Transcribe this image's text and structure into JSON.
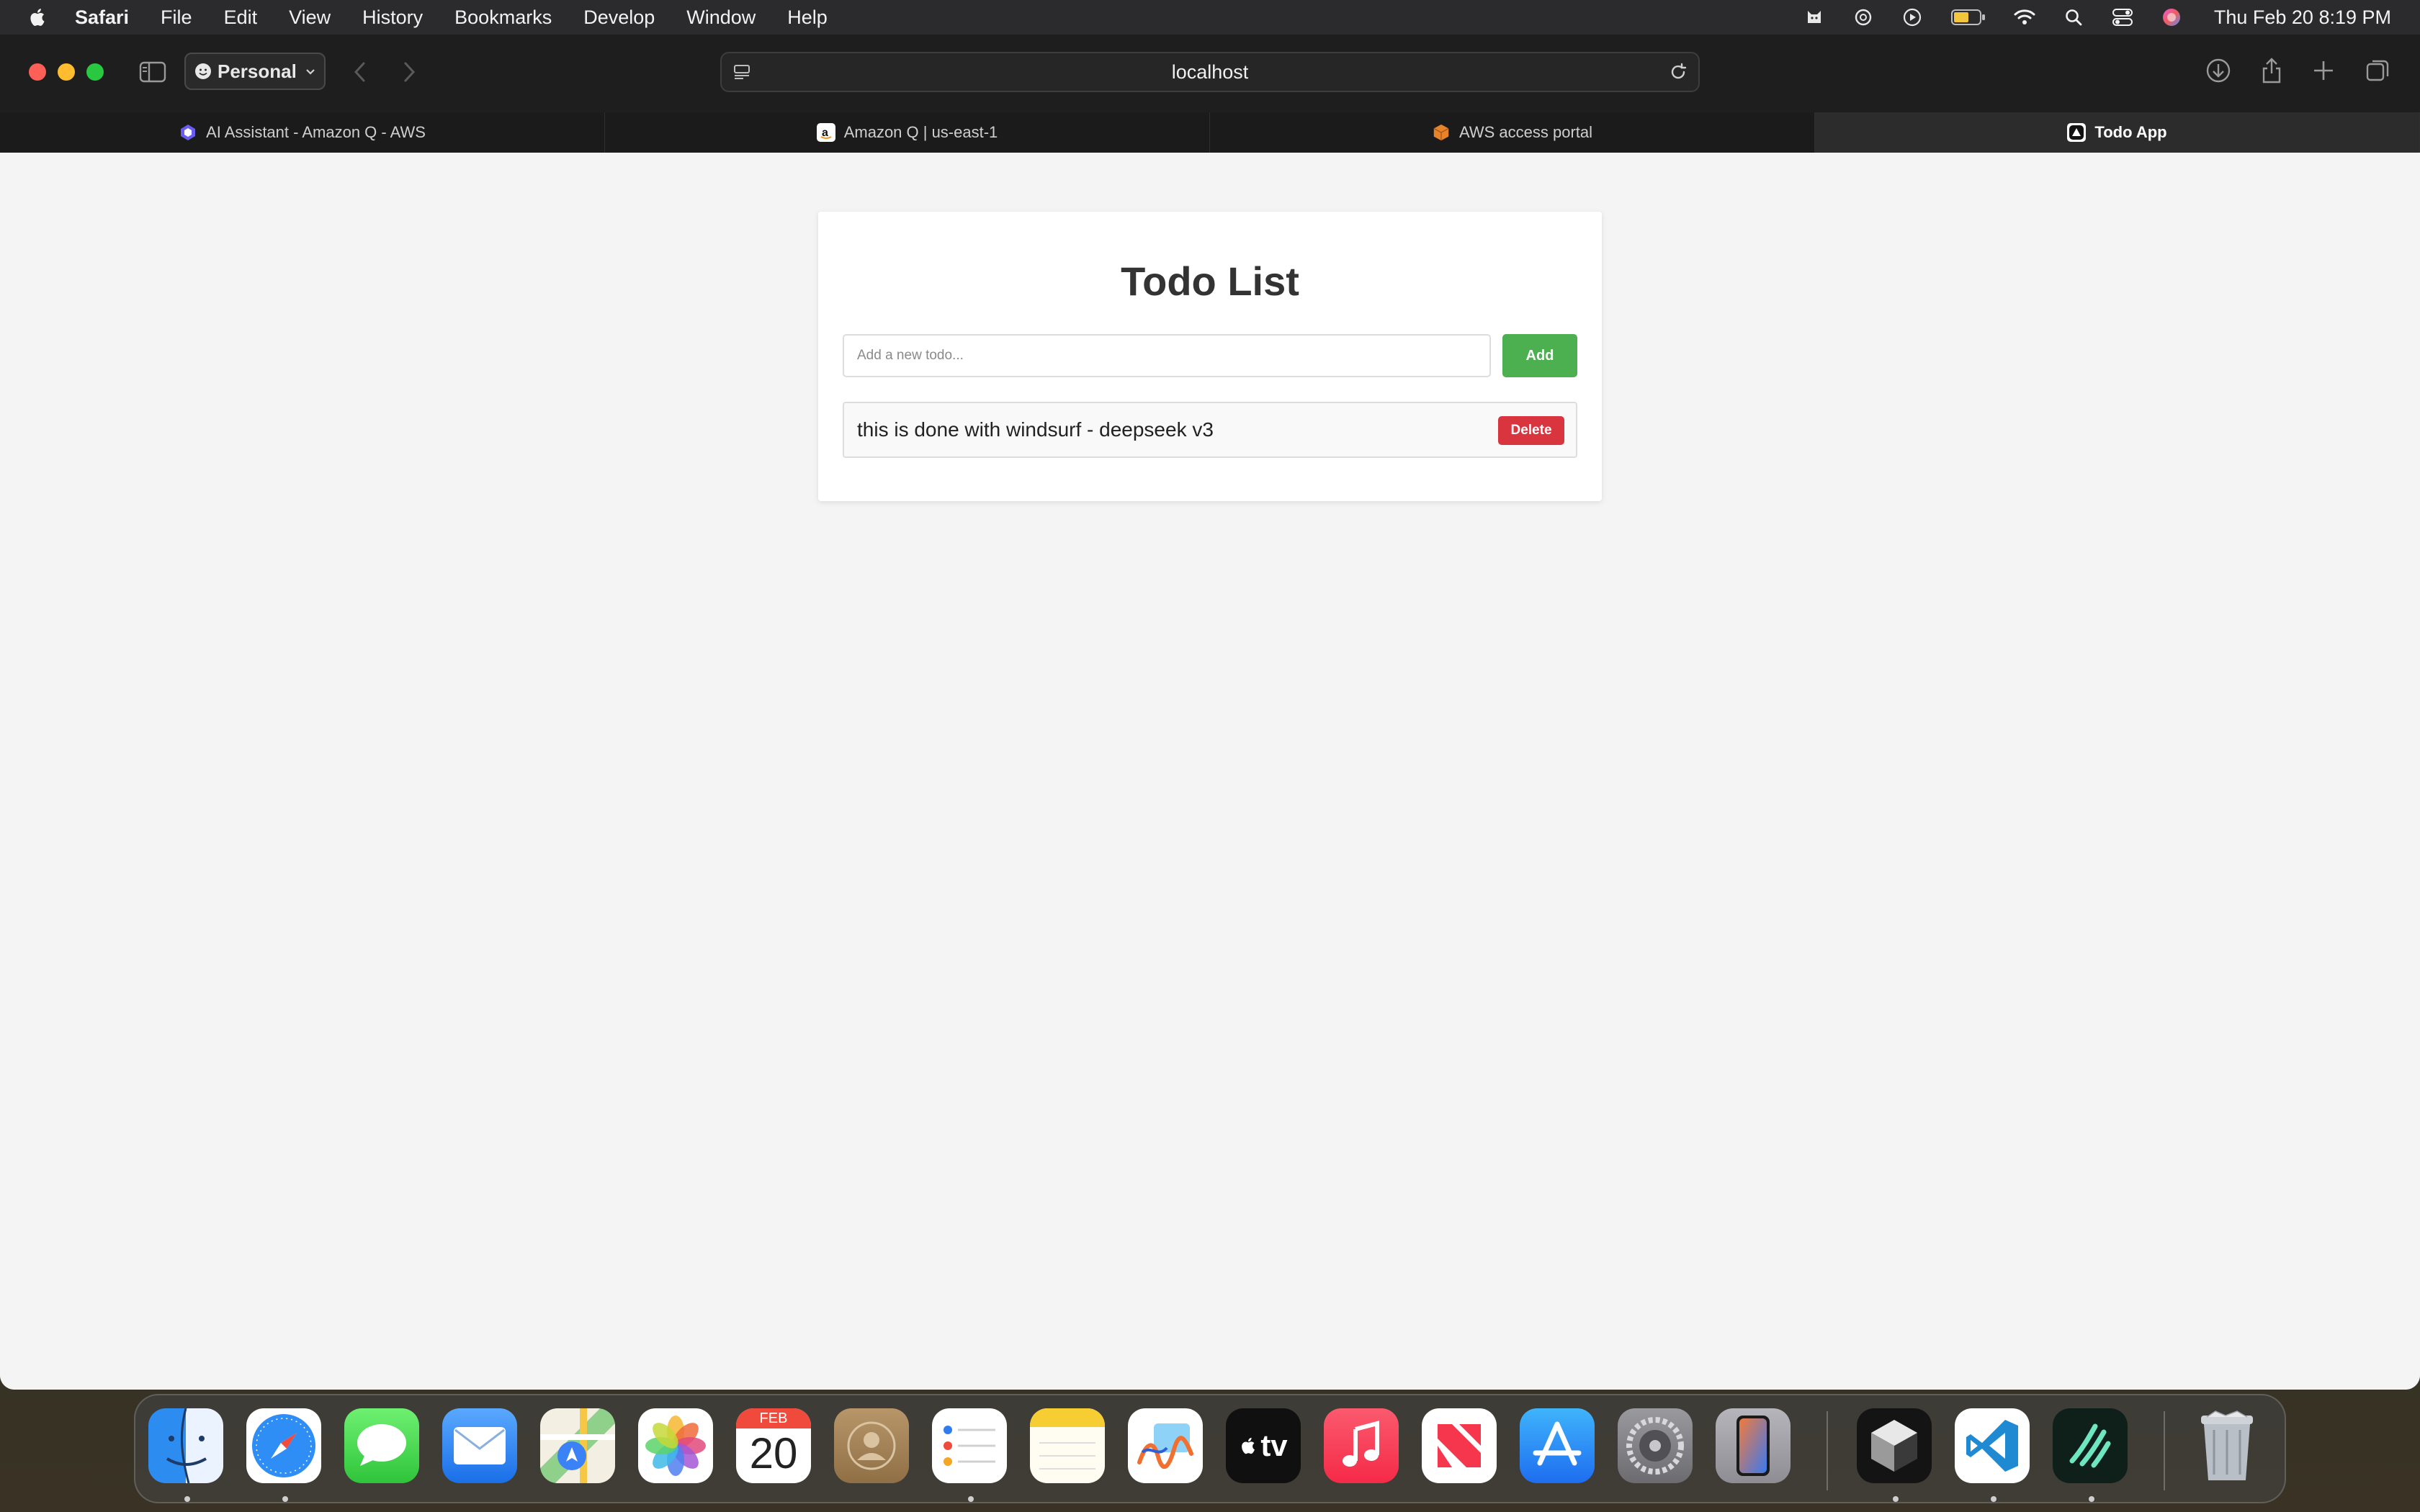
{
  "menubar": {
    "app_name": "Safari",
    "items": [
      "File",
      "Edit",
      "View",
      "History",
      "Bookmarks",
      "Develop",
      "Window",
      "Help"
    ],
    "clock": "Thu Feb 20  8:19 PM"
  },
  "browser": {
    "profile_label": "Personal",
    "address": "localhost",
    "tabs": [
      {
        "label": "AI Assistant - Amazon Q - AWS",
        "icon": "amazon-q-icon"
      },
      {
        "label": "Amazon Q | us-east-1",
        "icon": "amazon-icon"
      },
      {
        "label": "AWS access portal",
        "icon": "aws-cube-icon"
      },
      {
        "label": "Todo App",
        "icon": "app-triangle-icon",
        "active": true
      }
    ]
  },
  "todo_app": {
    "title": "Todo List",
    "input_placeholder": "Add a new todo...",
    "add_label": "Add",
    "items": [
      {
        "text": "this is done with windsurf - deepseek v3",
        "delete_label": "Delete"
      }
    ]
  },
  "dock": {
    "calendar_month": "FEB",
    "calendar_day": "20",
    "tv_label": "tv",
    "apps": [
      "Finder",
      "Safari",
      "Messages",
      "Mail",
      "Maps",
      "Photos",
      "Calendar",
      "Contacts",
      "Reminders",
      "Notes",
      "Freeform",
      "TV",
      "Music",
      "News",
      "App Store",
      "System Settings",
      "iPhone Mirroring",
      "Cursor",
      "Visual Studio Code",
      "Windsurf",
      "Trash"
    ]
  },
  "colors": {
    "add_button": "#4caf50",
    "delete_button": "#d9353f",
    "page_background": "#f4f4f4"
  }
}
